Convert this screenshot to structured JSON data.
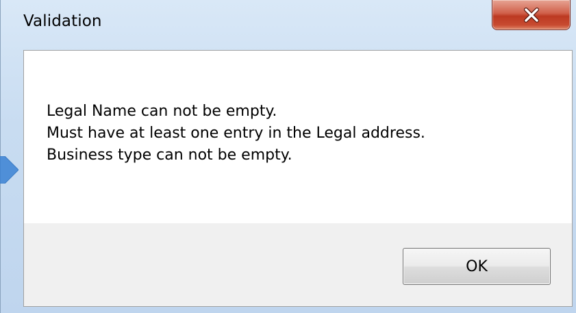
{
  "window": {
    "title": "Validation",
    "close_icon": "close-icon",
    "colors": {
      "frame": "#c8dcf1",
      "close_button": "#c84a30",
      "pointer": "#4f8fd8"
    }
  },
  "dialog": {
    "messages": [
      "Legal Name can not be empty.",
      "Must have at least one entry in the Legal address.",
      "Business type can not be empty."
    ],
    "ok_label": "OK"
  }
}
